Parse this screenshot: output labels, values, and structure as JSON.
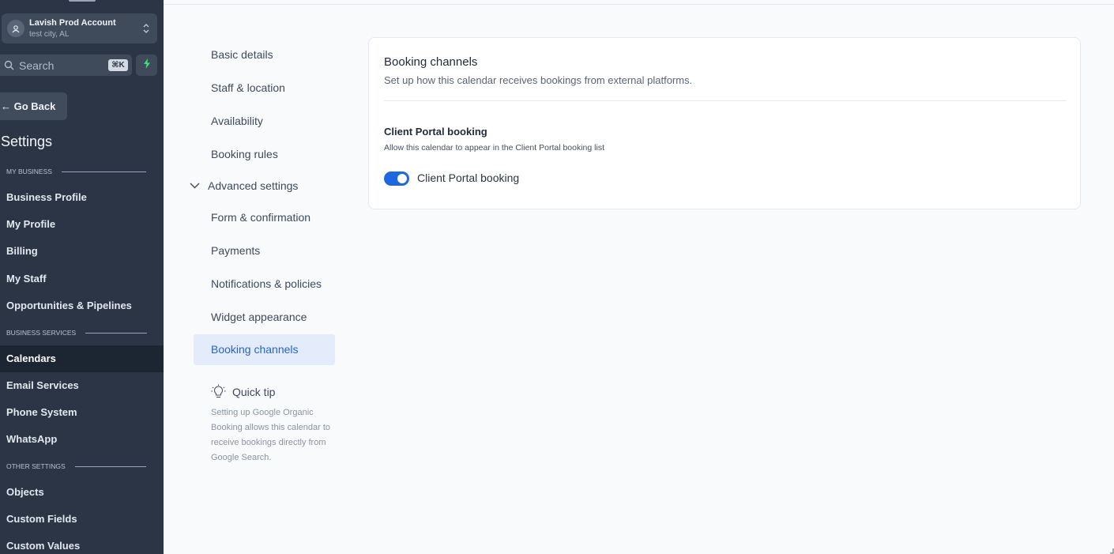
{
  "account": {
    "name": "Lavish Prod Account",
    "location": "test city, AL"
  },
  "search": {
    "placeholder": "Search",
    "shortcut": "⌘K"
  },
  "sidebar": {
    "go_back": "← Go Back",
    "title": "Settings",
    "sections": [
      {
        "label": "MY BUSINESS"
      },
      {
        "label": "BUSINESS SERVICES"
      },
      {
        "label": "OTHER SETTINGS"
      }
    ],
    "items": [
      {
        "label": "Business Profile"
      },
      {
        "label": "My Profile"
      },
      {
        "label": "Billing"
      },
      {
        "label": "My Staff"
      },
      {
        "label": "Opportunities & Pipelines"
      },
      {
        "label": "Calendars",
        "active": true
      },
      {
        "label": "Email Services"
      },
      {
        "label": "Phone System"
      },
      {
        "label": "WhatsApp"
      },
      {
        "label": "Objects"
      },
      {
        "label": "Custom Fields"
      },
      {
        "label": "Custom Values"
      }
    ]
  },
  "subnav": {
    "items": [
      {
        "label": "Basic details"
      },
      {
        "label": "Staff & location"
      },
      {
        "label": "Availability"
      },
      {
        "label": "Booking rules"
      },
      {
        "label": "Advanced settings"
      },
      {
        "label": "Form & confirmation"
      },
      {
        "label": "Payments"
      },
      {
        "label": "Notifications & policies"
      },
      {
        "label": "Widget appearance"
      },
      {
        "label": "Booking channels",
        "active": true
      }
    ],
    "tip": {
      "title": "Quick tip",
      "body": "Setting up Google Organic Booking allows this calendar to receive bookings directly from Google Search."
    }
  },
  "card": {
    "title": "Booking channels",
    "description": "Set up how this calendar receives bookings from external platforms.",
    "section": {
      "title": "Client Portal booking",
      "description": "Allow this calendar to appear in the Client Portal booking list",
      "toggle_label": "Client Portal booking",
      "toggle_on": true
    }
  },
  "colors": {
    "sidebar_bg": "#2b3545",
    "accent": "#1d67e0",
    "active_subnav_bg": "#e4ecfb"
  }
}
